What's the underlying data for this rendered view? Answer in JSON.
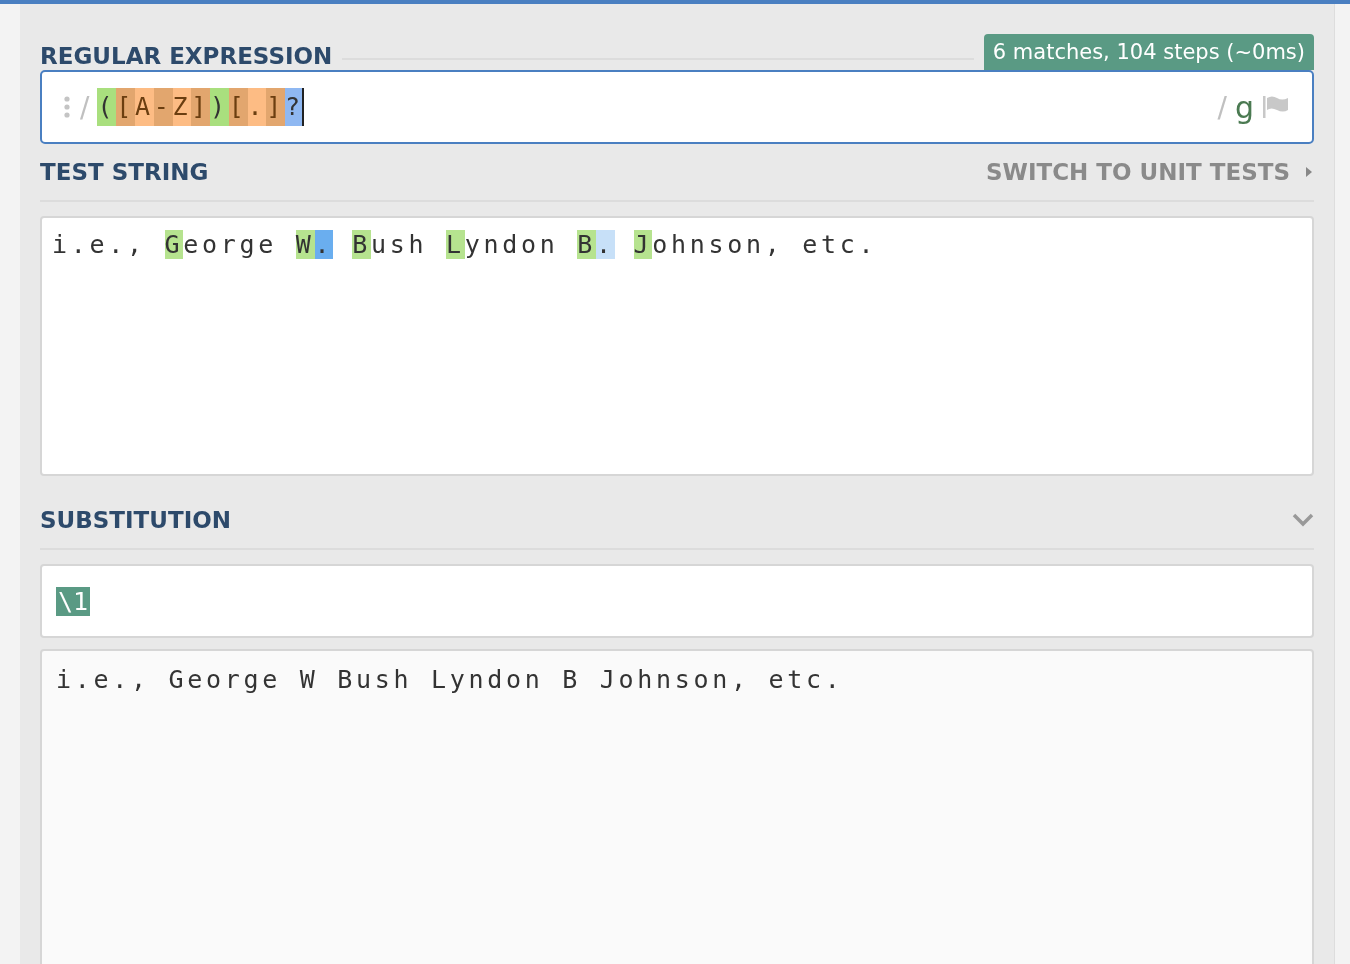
{
  "regex": {
    "heading": "REGULAR EXPRESSION",
    "status": "6 matches, 104 steps (~0ms)",
    "delimiter": "/",
    "closing_delimiter": "/",
    "flags": "g",
    "tokens": [
      {
        "text": "(",
        "kind": "group"
      },
      {
        "text": "[",
        "kind": "class"
      },
      {
        "text": "A",
        "kind": "class-inner"
      },
      {
        "text": "-",
        "kind": "class"
      },
      {
        "text": "Z",
        "kind": "class-inner"
      },
      {
        "text": "]",
        "kind": "class"
      },
      {
        "text": ")",
        "kind": "group"
      },
      {
        "text": "[",
        "kind": "class"
      },
      {
        "text": ".",
        "kind": "class-inner"
      },
      {
        "text": "]",
        "kind": "class"
      },
      {
        "text": "?",
        "kind": "quantifier"
      }
    ]
  },
  "test_string": {
    "heading": "TEST STRING",
    "switch_link": "SWITCH TO UNIT TESTS",
    "words": [
      {
        "parts": [
          {
            "text": "i.e.,",
            "kind": "plain"
          }
        ]
      },
      {
        "parts": [
          {
            "text": "G",
            "kind": "group"
          },
          {
            "text": "eorge",
            "kind": "plain"
          }
        ]
      },
      {
        "parts": [
          {
            "text": "W",
            "kind": "group"
          },
          {
            "text": ".",
            "kind": "match"
          }
        ]
      },
      {
        "parts": [
          {
            "text": "B",
            "kind": "group"
          },
          {
            "text": "ush",
            "kind": "plain"
          }
        ]
      },
      {
        "parts": [
          {
            "text": "L",
            "kind": "group"
          },
          {
            "text": "yndon",
            "kind": "plain"
          }
        ]
      },
      {
        "parts": [
          {
            "text": "B",
            "kind": "group"
          },
          {
            "text": ".",
            "kind": "match-alt"
          }
        ]
      },
      {
        "parts": [
          {
            "text": "J",
            "kind": "group"
          },
          {
            "text": "ohnson,",
            "kind": "plain"
          }
        ]
      },
      {
        "parts": [
          {
            "text": "etc.",
            "kind": "plain"
          }
        ]
      }
    ]
  },
  "substitution": {
    "heading": "SUBSTITUTION",
    "expanded": true,
    "pattern": "\\1",
    "result": "i.e., George W Bush Lyndon B Johnson, etc."
  }
}
